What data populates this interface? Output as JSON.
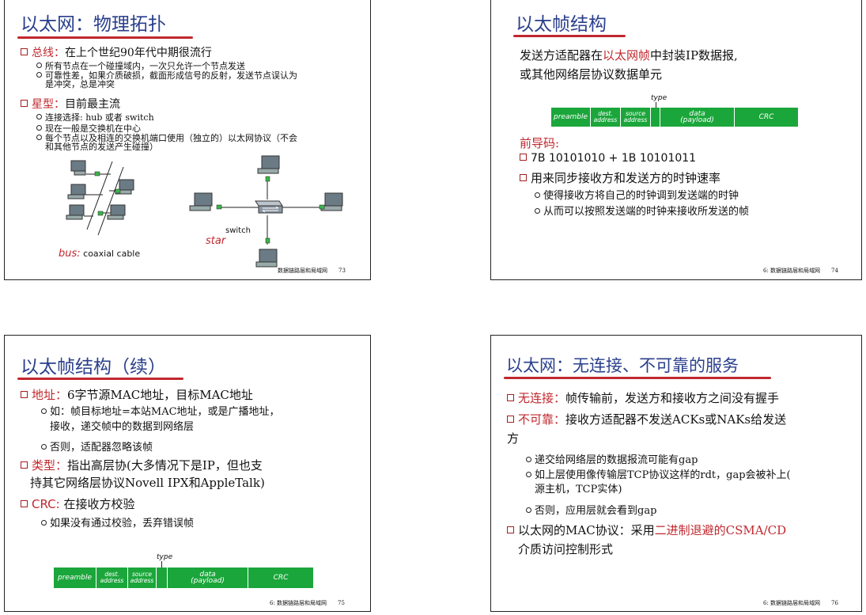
{
  "slide73": {
    "title": "以太网：物理拓扑",
    "b1_head": "总线：",
    "b1_rest": "在上个世纪90年代中期很流行",
    "b1_sub1": "所有节点在一个碰撞域内，一次只允许一个节点发送",
    "b1_sub2a": "可靠性差，如果介质破损，截面形成信号的反射，发送节点误认为",
    "b1_sub2b": "是冲突，总是冲突",
    "b2_head": "星型：",
    "b2_rest": "目前最主流",
    "b2_sub1": "连接选择: hub 或者 switch",
    "b2_sub2": "现在一般是交换机在中心",
    "b2_sub3a": "每个节点以及相连的交换机端口使用（独立的）以太网协议（不会",
    "b2_sub3b": "和其他节点的发送产生碰撞）",
    "bus_label": "bus:",
    "bus_text": "coaxial cable",
    "switch_label": "switch",
    "star_label": "star",
    "footer": "数据链路层和局域网",
    "page": "73"
  },
  "slide74": {
    "title": "以太帧结构",
    "intro1a": "发送方适配器在",
    "intro1b": "以太网帧",
    "intro1c": "中封装IP数据报,",
    "intro2": "或其他网络层协议数据单元",
    "type_label": "type",
    "frame": [
      "preamble",
      "dest.\naddress",
      "source\naddress",
      "",
      "data\n(payload)",
      "CRC"
    ],
    "preamble_head": "前导码:",
    "p1": "7B 10101010 + 1B 10101011",
    "p2": "用来同步接收方和发送方的时钟速率",
    "p2_sub1": "使得接收方将自己的时钟调到发送端的时钟",
    "p2_sub2": "从而可以按照发送端的时钟来接收所发送的帧",
    "footer": "6: 数据链路层和局域网",
    "page": "74"
  },
  "slide75": {
    "title": "以太帧结构（续）",
    "a_head": "地址：",
    "a_rest": "6字节源MAC地址，目标MAC地址",
    "a_sub1a": "如：帧目标地址=本站MAC地址，或是广播地址，",
    "a_sub1b": "接收，递交帧中的数据到网络层",
    "a_sub2": "否则，适配器忽略该帧",
    "t_head": "类型：",
    "t_rest": "指出高层协(大多情况下是IP，但也支",
    "t_rest2": "持其它网络层协议Novell IPX和AppleTalk)",
    "c_head": "CRC:",
    "c_rest": "在接收方校验",
    "c_sub1": "如果没有通过校验，丢弃错误帧",
    "type_label": "type",
    "frame": [
      "preamble",
      "dest.\naddress",
      "source\naddress",
      "",
      "data\n(payload)",
      "CRC"
    ],
    "footer": "6: 数据链路层和局域网",
    "page": "75"
  },
  "slide76": {
    "title": "以太网：无连接、不可靠的服务",
    "b1_head": "无连接：",
    "b1_rest": "帧传输前，发送方和接收方之间没有握手",
    "b2_head": "不可靠：",
    "b2_rest": "接收方适配器不发送ACKs或NAKs给发送",
    "b2_rest2": "方",
    "b2_sub1": "递交给网络层的数据报流可能有gap",
    "b2_sub2a": "如上层使用像传输层TCP协议这样的rdt，gap会被补上(",
    "b2_sub2b": "源主机，TCP实体)",
    "b2_sub3": "否则，应用层就会看到gap",
    "b3_a": "以太网的MAC协议：采用",
    "b3_b": "二进制退避的CSMA/CD",
    "b3_c": "介质访问控制形式",
    "footer": "6: 数据链路层和局域网",
    "page": "76"
  }
}
